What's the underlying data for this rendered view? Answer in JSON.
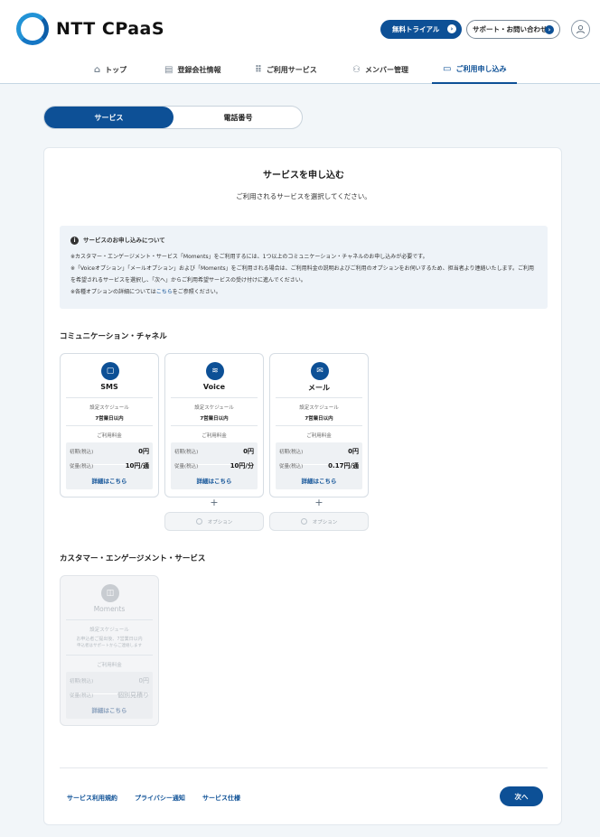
{
  "header": {
    "logo_text": "NTT CPaaS",
    "trial_button": "無料トライアル",
    "support_button": "サポート・お問い合わせ"
  },
  "nav": {
    "items": [
      {
        "label": "トップ",
        "icon": "home-icon"
      },
      {
        "label": "登録会社情報",
        "icon": "document-icon"
      },
      {
        "label": "ご利用サービス",
        "icon": "grid-icon"
      },
      {
        "label": "メンバー管理",
        "icon": "members-icon"
      },
      {
        "label": "ご利用申し込み",
        "icon": "application-icon",
        "active": true
      }
    ]
  },
  "tabs": {
    "service": "サービス",
    "phone": "電話番号",
    "selected": "サービス"
  },
  "main": {
    "title": "サービスを申し込む",
    "subtitle": "ご利用されるサービスを選択してください。",
    "notice": {
      "title": "サービスのお申し込みについて",
      "line1": "※カスタマー・エンゲージメント・サービス「Moments」をご利用するには、1つ以上のコミュニケーション・チャネルのお申し込みが必要です。",
      "line2": "※「Voiceオプション」「メールオプション」および「Moments」をご利用される場合は、ご利用料金の説明およびご利用のオプションをお伺いするため、担当者より連絡いたします。ご利用を希望されるサービスを選択し、「次へ」からご利用希望サービスの受け付けに進んでください。",
      "line3_prefix": "※各種オプションの詳細については",
      "line3_link": "こちら",
      "line3_suffix": "をご参照ください。"
    },
    "channels_title": "コミュニケーション・チャネル",
    "engagement_title": "カスタマー・エンゲージメント・サービス"
  },
  "channels": [
    {
      "name": "SMS",
      "icon": "message-icon",
      "schedule_label": "設定スケジュール",
      "schedule": "7営業日以内",
      "fee_label": "ご利用料金",
      "initial_label": "初期(税込)",
      "initial": "0円",
      "usage_label": "従量(税込)",
      "usage": "10円/通",
      "detail": "詳細はこちら"
    },
    {
      "name": "Voice",
      "icon": "voice-icon",
      "schedule_label": "設定スケジュール",
      "schedule": "7営業日以内",
      "fee_label": "ご利用料金",
      "initial_label": "初期(税込)",
      "initial": "0円",
      "usage_label": "従量(税込)",
      "usage": "10円/分",
      "detail": "詳細はこちら",
      "option": "オプション"
    },
    {
      "name": "メール",
      "icon": "mail-icon",
      "schedule_label": "設定スケジュール",
      "schedule": "7営業日以内",
      "fee_label": "ご利用料金",
      "initial_label": "初期(税込)",
      "initial": "0円",
      "usage_label": "従量(税込)",
      "usage": "0.17円/通",
      "detail": "詳細はこちら",
      "option": "オプション"
    }
  ],
  "engagement": {
    "name": "Moments",
    "icon": "chat-icon",
    "schedule_label": "設定スケジュール",
    "schedule": "お申込者ご提出後、7営業日以内",
    "schedule_note": "申込者はサポートからご連絡します",
    "fee_label": "ご利用料金",
    "initial_label": "初期(税込)",
    "initial": "0円",
    "usage_label": "従量(税込)",
    "usage": "個別見積り",
    "detail": "詳細はこちら"
  },
  "footer": {
    "terms": "サービス利用規約",
    "privacy": "プライバシー通知",
    "spec": "サービス仕様",
    "next": "次へ"
  }
}
